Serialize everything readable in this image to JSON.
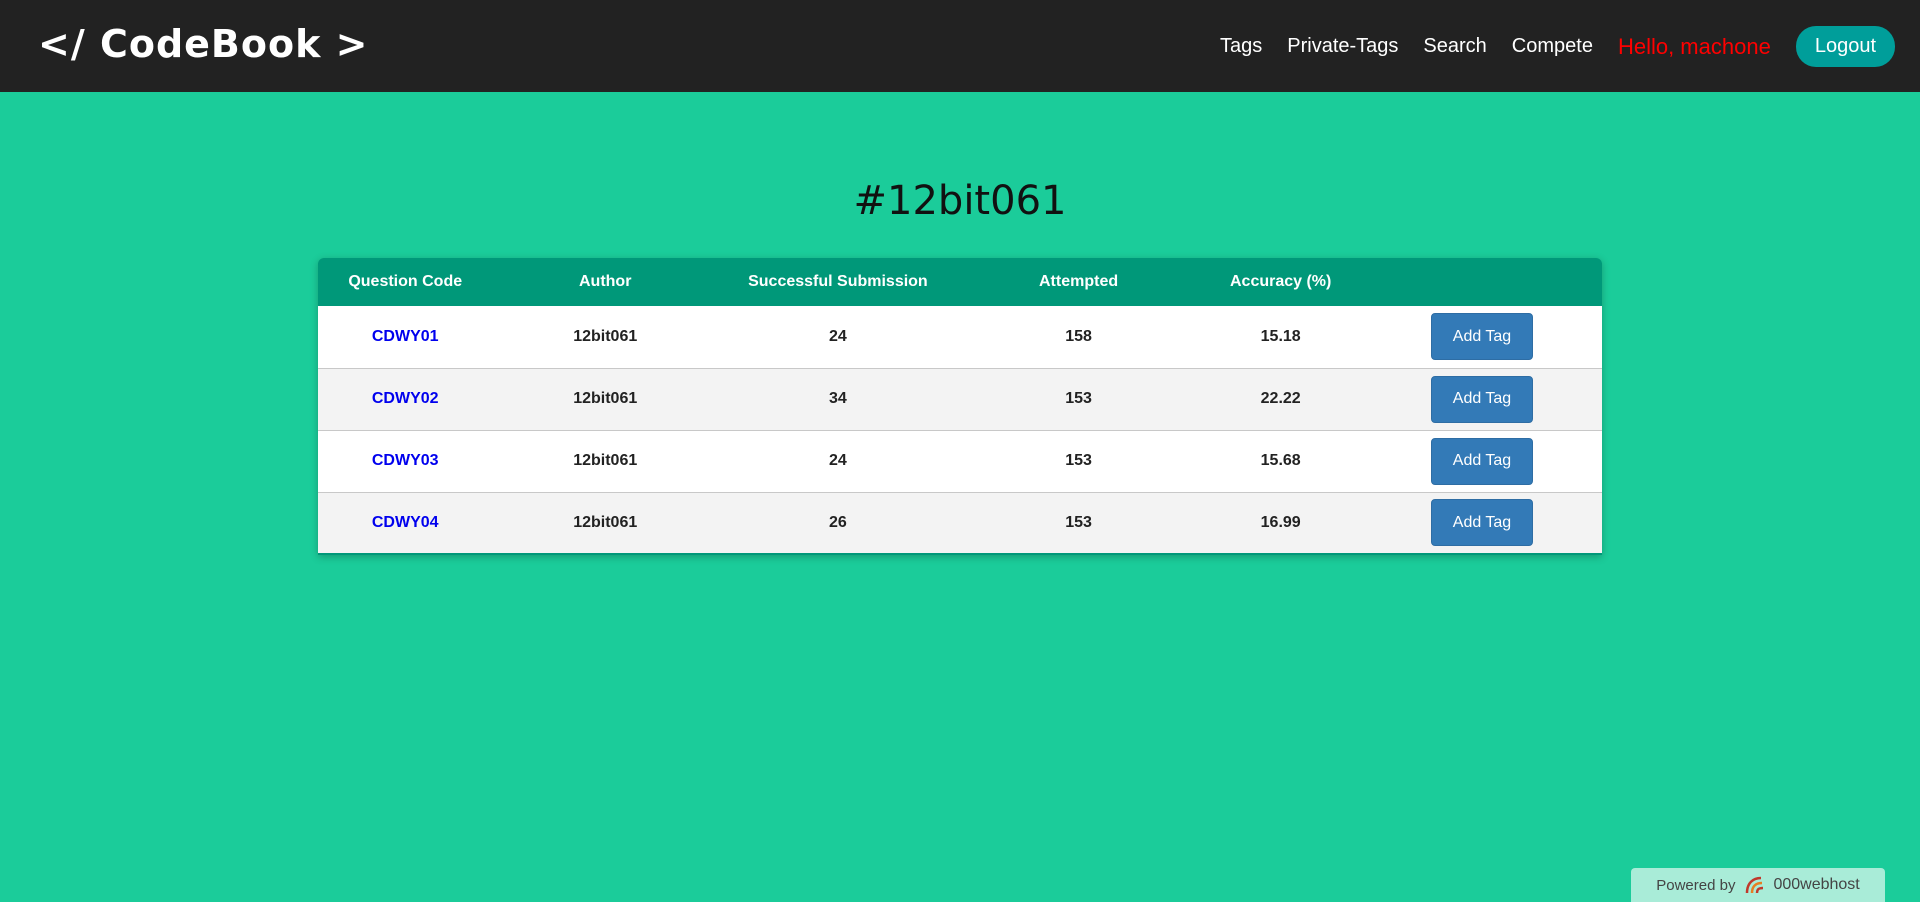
{
  "navbar": {
    "brand": "</ CodeBook >",
    "links": [
      "Tags",
      "Private-Tags",
      "Search",
      "Compete"
    ],
    "greeting": "Hello, machone",
    "logout_label": "Logout"
  },
  "page": {
    "title": "#12bit061"
  },
  "table": {
    "headers": [
      "Question Code",
      "Author",
      "Successful Submission",
      "Attempted",
      "Accuracy (%)",
      ""
    ],
    "rows": [
      {
        "code": "CDWY01",
        "author": "12bit061",
        "successful": "24",
        "attempted": "158",
        "accuracy": "15.18",
        "action": "Add Tag"
      },
      {
        "code": "CDWY02",
        "author": "12bit061",
        "successful": "34",
        "attempted": "153",
        "accuracy": "22.22",
        "action": "Add Tag"
      },
      {
        "code": "CDWY03",
        "author": "12bit061",
        "successful": "24",
        "attempted": "153",
        "accuracy": "15.68",
        "action": "Add Tag"
      },
      {
        "code": "CDWY04",
        "author": "12bit061",
        "successful": "26",
        "attempted": "153",
        "accuracy": "16.99",
        "action": "Add Tag"
      }
    ]
  },
  "footer_badge": {
    "powered_by": "Powered by",
    "host": "000webhost",
    "icon": "webhost-logo-icon"
  },
  "colors": {
    "background": "#1bcc9a",
    "navbar": "#222222",
    "greeting": "#ff0000",
    "logout": "#009e9a",
    "table_header": "#009879",
    "button": "#337ab7",
    "link": "#0000ee"
  }
}
